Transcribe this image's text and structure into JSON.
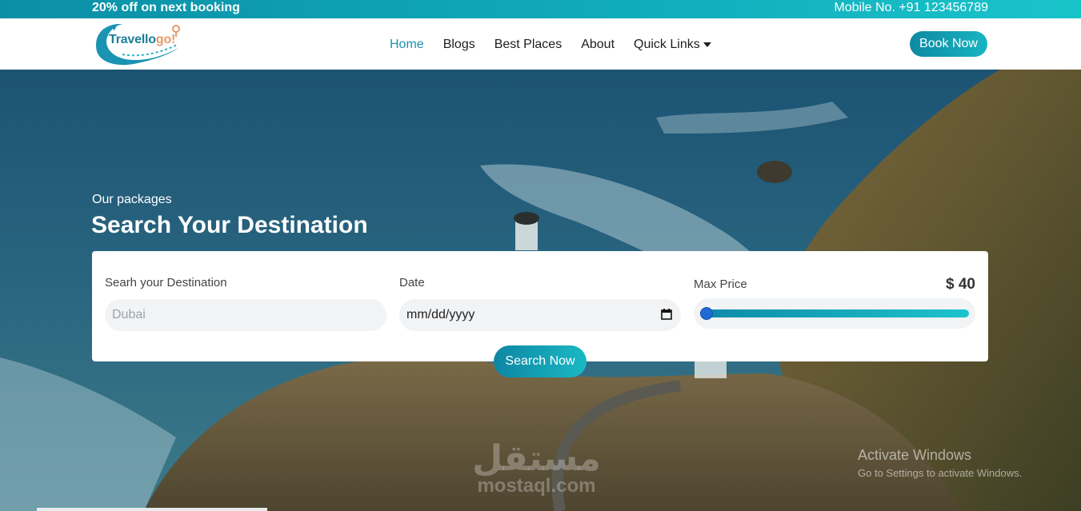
{
  "topbar": {
    "offer": "20% off on next booking",
    "phone": "Mobile No. +91 123456789"
  },
  "logo": {
    "text_main": "Travello",
    "text_accent": "go!"
  },
  "nav": {
    "items": [
      {
        "label": "Home",
        "active": true
      },
      {
        "label": "Blogs",
        "active": false
      },
      {
        "label": "Best Places",
        "active": false
      },
      {
        "label": "About",
        "active": false
      },
      {
        "label": "Quick Links",
        "active": false,
        "dropdown": true
      }
    ],
    "book_now": "Book Now"
  },
  "hero": {
    "subtitle": "Our packages",
    "title": "Search Your Destination"
  },
  "search": {
    "destination_label": "Searh your Destination",
    "destination_placeholder": "Dubai",
    "date_label": "Date",
    "date_value": "mm/dd/yyyy",
    "price_label": "Max Price",
    "price_value": "$ 40",
    "price_slider_fraction": 0.0,
    "button": "Search Now"
  },
  "watermark": {
    "arabic": "مستقل",
    "latin": "mostaql.com"
  },
  "windows": {
    "title": "Activate Windows",
    "subtitle": "Go to Settings to activate Windows."
  },
  "colors": {
    "brand_teal": "#1a94b0",
    "button_gradient_start": "#0e8aa3",
    "button_gradient_end": "#18b4c2",
    "slider_thumb": "#1f6bd6"
  }
}
